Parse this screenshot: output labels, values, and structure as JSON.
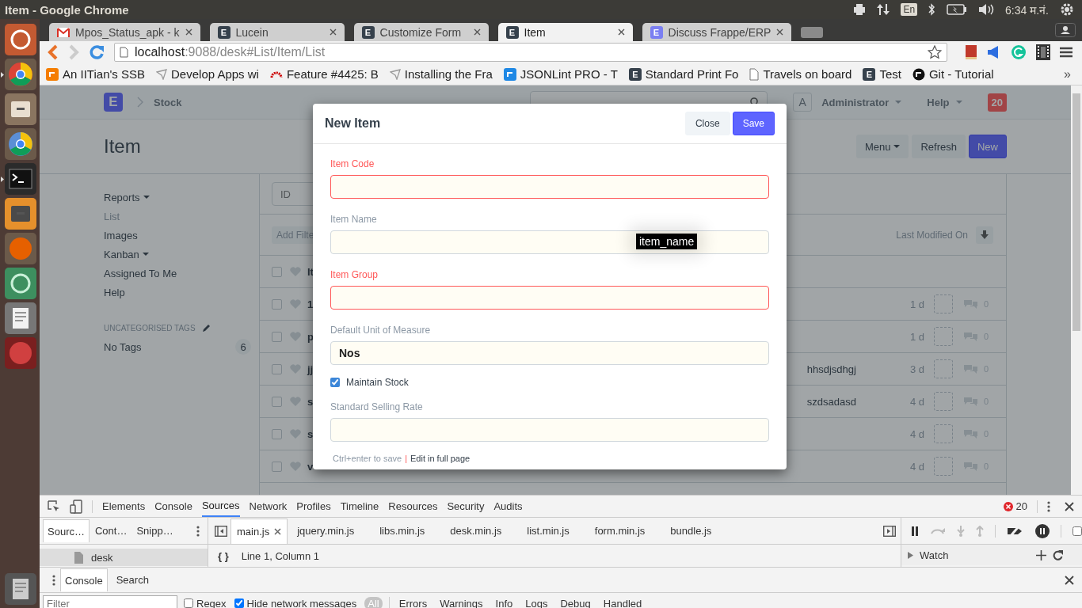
{
  "os_bar": {
    "title": "Item - Google Chrome",
    "keyboard": "En",
    "clock": "6:34 म.नं."
  },
  "launcher": [
    {
      "kind": "dash",
      "running": false
    },
    {
      "kind": "chrome",
      "running": true
    },
    {
      "kind": "files",
      "running": false
    },
    {
      "kind": "chromium",
      "running": false
    },
    {
      "kind": "terminal",
      "running": true
    },
    {
      "kind": "sublime",
      "running": false
    },
    {
      "kind": "firefox",
      "running": false
    },
    {
      "kind": "atom",
      "running": false
    },
    {
      "kind": "editor",
      "running": false
    },
    {
      "kind": "disk",
      "running": false
    },
    {
      "kind": "trash",
      "running": false
    }
  ],
  "browser": {
    "tabs": [
      {
        "title": "Mpos_Status_apk - k",
        "kind": "mail",
        "selected": false
      },
      {
        "title": "Lucein",
        "kind": "badge",
        "badge": "E",
        "selected": false
      },
      {
        "title": "Customize Form",
        "kind": "badge",
        "badge": "E",
        "selected": false
      },
      {
        "title": "Item",
        "kind": "badge",
        "badge": "E",
        "selected": true
      },
      {
        "title": "Discuss Frappe/ERP",
        "kind": "badge-light",
        "badge": "E",
        "selected": false
      }
    ],
    "url_host": "localhost",
    "url_rest": ":9088/desk#List/Item/List",
    "bookmarks": [
      {
        "label": "An IITian's SSB",
        "kind": "blogger"
      },
      {
        "label": "Develop Apps wi",
        "kind": "pin"
      },
      {
        "label": "Feature #4425: B",
        "kind": "arc"
      },
      {
        "label": "Installing the Fra",
        "kind": "pin"
      },
      {
        "label": "JSONLint PRO - T",
        "kind": "json"
      },
      {
        "label": "Standard Print Fo",
        "kind": "badge",
        "badge": "E"
      },
      {
        "label": "Travels on board",
        "kind": "page"
      },
      {
        "label": "Test",
        "kind": "badge",
        "badge": "E"
      },
      {
        "label": "Git - Tutorial",
        "kind": "cat"
      }
    ],
    "bookmarks_more": "»"
  },
  "page": {
    "logo": "E",
    "module": "Stock",
    "user_initial": "A",
    "user": "Administrator",
    "help": "Help",
    "notifications": "20",
    "title": "Item",
    "actions": [
      {
        "label": "Menu",
        "kind": "dropdown"
      },
      {
        "label": "Refresh",
        "kind": "default"
      },
      {
        "label": "New",
        "kind": "primary"
      }
    ],
    "sidebar": [
      {
        "label": "Reports",
        "dropdown": true,
        "selected": false
      },
      {
        "label": "List",
        "dropdown": false,
        "selected": true
      },
      {
        "label": "Images",
        "dropdown": false,
        "selected": false
      },
      {
        "label": "Kanban",
        "dropdown": true,
        "selected": false
      },
      {
        "label": "Assigned To Me",
        "dropdown": false,
        "selected": false
      },
      {
        "label": "Help",
        "dropdown": false,
        "selected": false
      }
    ],
    "tags_heading": "UNCATEGORISED TAGS",
    "tags": [
      {
        "label": "No Tags",
        "count": "6"
      }
    ],
    "list": {
      "id_placeholder": "ID",
      "add_filter": "Add Filte",
      "sort_label": "Last Modified On",
      "header": {
        "label": "It",
        "checked": false
      },
      "rows": [
        {
          "name": "1",
          "checked": false,
          "modified": "1 d",
          "comments": "0"
        },
        {
          "name": "p",
          "checked": false,
          "modified": "1 d",
          "comments": "0"
        },
        {
          "name": "jj",
          "checked": false,
          "extra": "hhsdjsdhgj",
          "modified": "3 d",
          "comments": "0"
        },
        {
          "name": "s",
          "checked": false,
          "extra": "szdsadasd",
          "modified": "4 d",
          "comments": "0"
        },
        {
          "name": "s",
          "checked": false,
          "modified": "4 d",
          "comments": "0"
        },
        {
          "name": "v",
          "checked": false,
          "modified": "4 d",
          "comments": "0"
        }
      ]
    }
  },
  "modal": {
    "title": "New Item",
    "close": "Close",
    "save": "Save",
    "fields": [
      {
        "kind": "input",
        "label": "Item Code",
        "required": true
      },
      {
        "kind": "input",
        "label": "Item Name",
        "required": false,
        "tooltip": "item_name"
      },
      {
        "kind": "input",
        "label": "Item Group",
        "required": true
      },
      {
        "kind": "input",
        "label": "Default Unit of Measure",
        "required": false,
        "value": "Nos"
      },
      {
        "kind": "checkbox",
        "label": "Maintain Stock",
        "checked": true
      },
      {
        "kind": "input",
        "label": "Standard Selling Rate",
        "required": false
      }
    ],
    "footer_hint": "Ctrl+enter to save",
    "footer_sep": "|",
    "footer_link": "Edit in full page"
  },
  "devtools": {
    "tabs": [
      {
        "label": "Elements",
        "selected": false
      },
      {
        "label": "Console",
        "selected": false
      },
      {
        "label": "Sources",
        "selected": true
      },
      {
        "label": "Network",
        "selected": false
      },
      {
        "label": "Profiles",
        "selected": false
      },
      {
        "label": "Timeline",
        "selected": false
      },
      {
        "label": "Resources",
        "selected": false
      },
      {
        "label": "Security",
        "selected": false
      },
      {
        "label": "Audits",
        "selected": false
      }
    ],
    "errors": "20",
    "navigator_tabs": [
      {
        "label": "Sourc…",
        "selected": true
      },
      {
        "label": "Cont…",
        "selected": false
      },
      {
        "label": "Snipp…",
        "selected": false
      }
    ],
    "files": [
      {
        "label": "main.js",
        "selected": true
      },
      {
        "label": "jquery.min.js",
        "selected": false
      },
      {
        "label": "libs.min.js",
        "selected": false
      },
      {
        "label": "desk.min.js",
        "selected": false
      },
      {
        "label": "list.min.js",
        "selected": false
      },
      {
        "label": "form.min.js",
        "selected": false
      },
      {
        "label": "bundle.js",
        "selected": false
      }
    ],
    "tree": [
      {
        "label": "desk",
        "selected": true
      }
    ],
    "format": "{ }",
    "position": "Line 1, Column 1",
    "async_checked": false,
    "watch": "Watch",
    "drawer_tabs": [
      {
        "label": "Console",
        "selected": true
      },
      {
        "label": "Search",
        "selected": false
      }
    ],
    "filter_placeholder": "Filter",
    "options": [
      {
        "label": "Regex",
        "checked": false
      },
      {
        "label": "Hide network messages",
        "checked": true
      }
    ],
    "levels": [
      {
        "label": "All",
        "selected": true
      },
      {
        "label": "Errors",
        "selected": false
      },
      {
        "label": "Warnings",
        "selected": false
      },
      {
        "label": "Info",
        "selected": false
      },
      {
        "label": "Logs",
        "selected": false
      },
      {
        "label": "Debug",
        "selected": false
      },
      {
        "label": "Handled",
        "selected": false
      }
    ]
  }
}
